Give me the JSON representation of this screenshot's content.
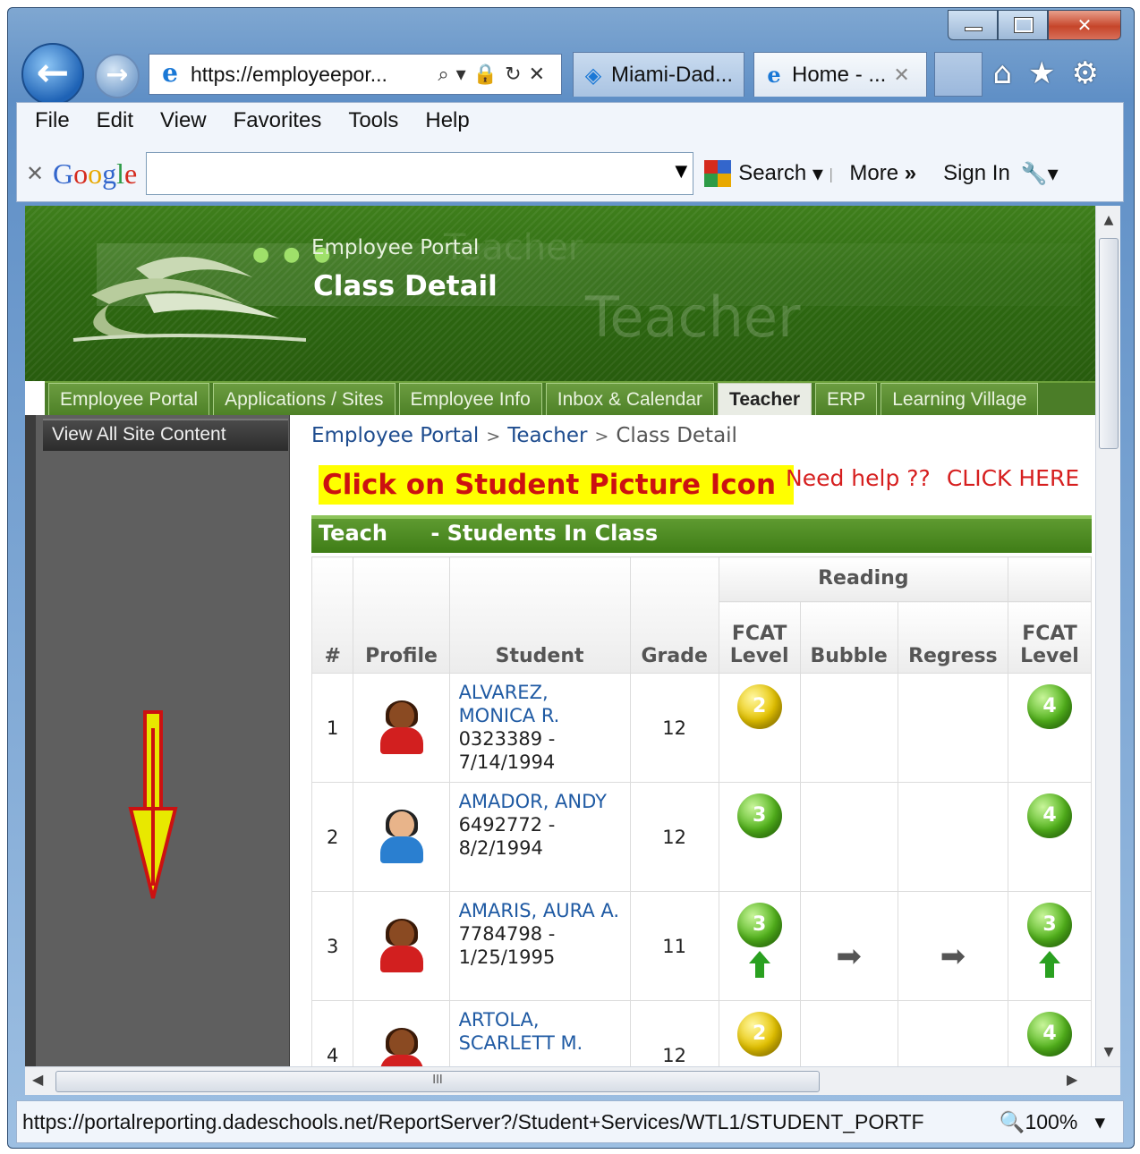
{
  "browser": {
    "address": "https://employeepor...",
    "tabs": [
      {
        "label": "Miami-Dad...",
        "active": false
      },
      {
        "label": "Home - ...",
        "active": true
      }
    ],
    "menu": [
      "File",
      "Edit",
      "View",
      "Favorites",
      "Tools",
      "Help"
    ],
    "google_toolbar": {
      "logo": "Google",
      "search_value": "",
      "search_label": "Search",
      "more_label": "More",
      "signin_label": "Sign In"
    },
    "status_url": "https://portalreporting.dadeschools.net/ReportServer?/Student+Services/WTL1/STUDENT_PORTF",
    "zoom": "100%"
  },
  "portal": {
    "portal_name": "Employee Portal",
    "page_heading": "Class Detail",
    "banner_word": "Teacher",
    "nav_tabs": [
      {
        "label": "Employee Portal",
        "active": false
      },
      {
        "label": "Applications / Sites",
        "active": false
      },
      {
        "label": "Employee Info",
        "active": false
      },
      {
        "label": "Inbox & Calendar",
        "active": false
      },
      {
        "label": "Teacher",
        "active": true
      },
      {
        "label": "ERP",
        "active": false
      },
      {
        "label": "Learning Village",
        "active": false
      }
    ],
    "sidebar_link": "View All Site Content",
    "breadcrumb": [
      "Employee Portal",
      "Teacher",
      "Class Detail"
    ],
    "callout": "Click on Student Picture Icon",
    "help_text": "Need help ??",
    "help_link": "CLICK HERE",
    "panel_title_left": "Teach",
    "panel_title_right": " - Students In Class"
  },
  "table": {
    "group_header": "Reading",
    "columns": {
      "num": "#",
      "profile": "Profile",
      "student": "Student",
      "grade": "Grade",
      "fcat_line1": "FCAT",
      "fcat_line2": "Level",
      "bubble": "Bubble",
      "regress": "Regress",
      "fcat2_line1": "FCAT",
      "fcat2_line2": "Level"
    },
    "rows": [
      {
        "num": "1",
        "name": "ALVAREZ, MONICA R.",
        "id_dob": "0323389 - 7/14/1994",
        "grade": "12",
        "gender": "female",
        "fcat": "2",
        "fcat_color": "yellow",
        "fcat_up": false,
        "bubble": "",
        "regress": "",
        "fcat2": "4",
        "fcat2_color": "green",
        "fcat2_up": false
      },
      {
        "num": "2",
        "name": "AMADOR, ANDY",
        "id_dob": "6492772 - 8/2/1994",
        "grade": "12",
        "gender": "male",
        "fcat": "3",
        "fcat_color": "green",
        "fcat_up": false,
        "bubble": "",
        "regress": "",
        "fcat2": "4",
        "fcat2_color": "green",
        "fcat2_up": false
      },
      {
        "num": "3",
        "name": "AMARIS, AURA A.",
        "id_dob": "7784798 - 1/25/1995",
        "grade": "11",
        "gender": "female",
        "fcat": "3",
        "fcat_color": "green",
        "fcat_up": true,
        "bubble": "right-arrow",
        "regress": "right-arrow",
        "fcat2": "3",
        "fcat2_color": "green",
        "fcat2_up": true
      },
      {
        "num": "4",
        "name": "ARTOLA, SCARLETT M.",
        "id_dob": "",
        "grade": "12",
        "gender": "female",
        "fcat": "2",
        "fcat_color": "yellow",
        "fcat_up": false,
        "bubble": "",
        "regress": "",
        "fcat2": "4",
        "fcat2_color": "green",
        "fcat2_up": false
      }
    ]
  },
  "colors": {
    "portal_green": "#3f7d17",
    "callout_bg": "#ffff00",
    "callout_text": "#cc1111",
    "link_blue": "#1f5aa3"
  }
}
